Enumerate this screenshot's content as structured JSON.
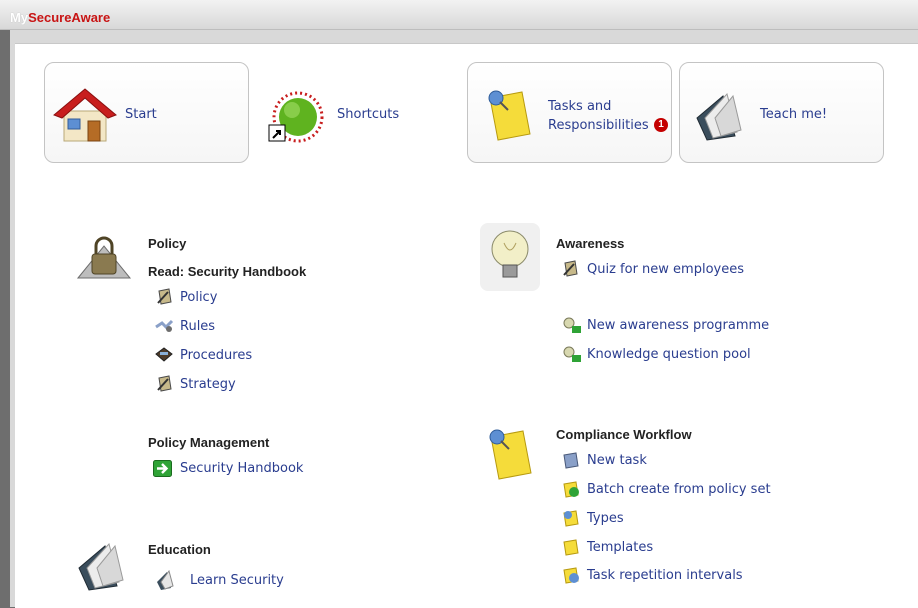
{
  "app": {
    "title_prefix": "My",
    "title_brand": "SecureAware"
  },
  "tiles": {
    "start": "Start",
    "shortcuts": "Shortcuts",
    "tasks_line1": "Tasks and",
    "tasks_line2": "Responsibilities",
    "tasks_badge": "1",
    "teach": "Teach me!"
  },
  "policy": {
    "heading": "Policy",
    "subheading": "Read: Security Handbook",
    "links": [
      "Policy",
      "Rules",
      "Procedures",
      "Strategy"
    ]
  },
  "policy_management": {
    "heading": "Policy Management",
    "links": [
      "Security Handbook"
    ]
  },
  "education": {
    "heading": "Education",
    "links": [
      "Learn Security"
    ]
  },
  "awareness": {
    "heading": "Awareness",
    "links": [
      "Quiz for new employees",
      "New awareness programme",
      "Knowledge question pool"
    ]
  },
  "compliance": {
    "heading": "Compliance Workflow",
    "links": [
      "New task",
      "Batch create from policy set",
      "Types",
      "Templates",
      "Task repetition intervals"
    ]
  },
  "colors": {
    "link": "#2a3d8f",
    "brand": "#c81414",
    "badge": "#c40000"
  }
}
